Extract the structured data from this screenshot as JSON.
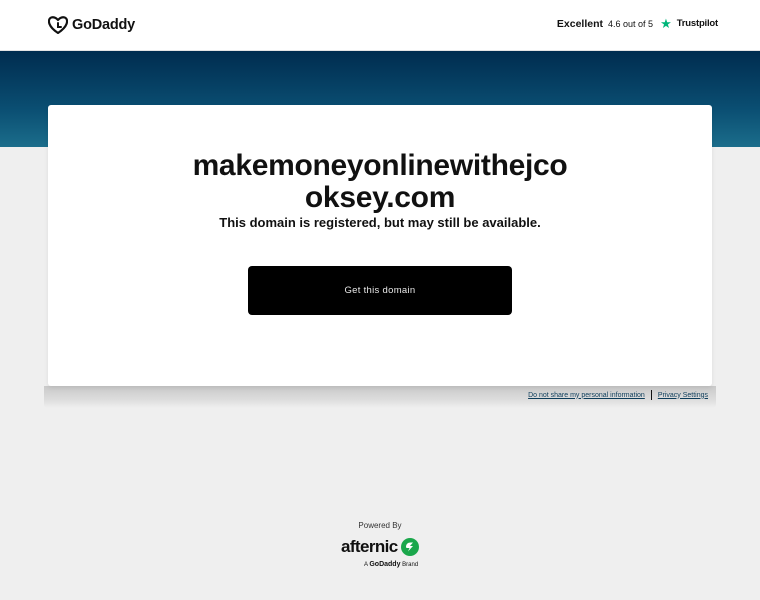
{
  "header": {
    "logo_text": "GoDaddy",
    "rating_label": "Excellent",
    "rating_score": "4.6 out of 5",
    "trustpilot_text": "Trustpilot",
    "brand_color": "#111111",
    "trustpilot_color": "#00b67a"
  },
  "hero": {
    "colors": [
      "#002c4f",
      "#1b6d8b"
    ]
  },
  "card": {
    "domain": "makemoneyonlinewithejcooksey.com",
    "status_text": "This domain is registered, but may still be available.",
    "cta_label": "Get this domain"
  },
  "footer_links": {
    "do_not_share": "Do not share my personal information",
    "privacy_settings": "Privacy Settings"
  },
  "powered_by": {
    "label": "Powered By",
    "brand_name": "afternic",
    "tagline_prefix": "A",
    "tagline_brand": "GoDaddy",
    "tagline_suffix": "Brand",
    "accent_color": "#1aa74b"
  }
}
